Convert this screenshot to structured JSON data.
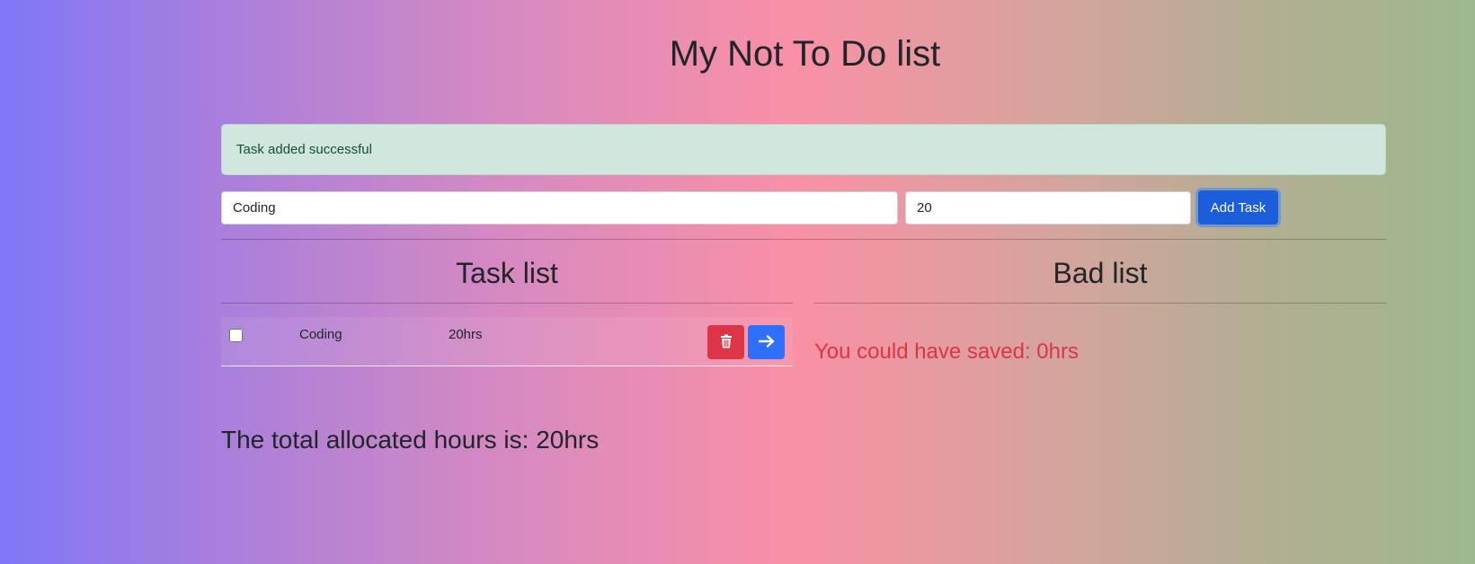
{
  "header": {
    "title": "My Not To Do list"
  },
  "alert": {
    "message": "Task added successful"
  },
  "form": {
    "task_value": "Coding",
    "hours_value": "20",
    "add_label": "Add Task"
  },
  "task_list": {
    "title": "Task list",
    "items": [
      {
        "task": "Coding",
        "hours": "20hrs"
      }
    ]
  },
  "bad_list": {
    "title": "Bad list",
    "saved_text": "You could have saved: 0hrs"
  },
  "summary": {
    "total_text": "The total allocated hours is: 20hrs"
  },
  "colors": {
    "success_bg": "#d1e7dd",
    "primary": "#1a5edb",
    "danger": "#dc3545",
    "move": "#2f6ffd"
  },
  "icons": {
    "delete": "trash-icon",
    "move": "arrow-right-icon"
  }
}
